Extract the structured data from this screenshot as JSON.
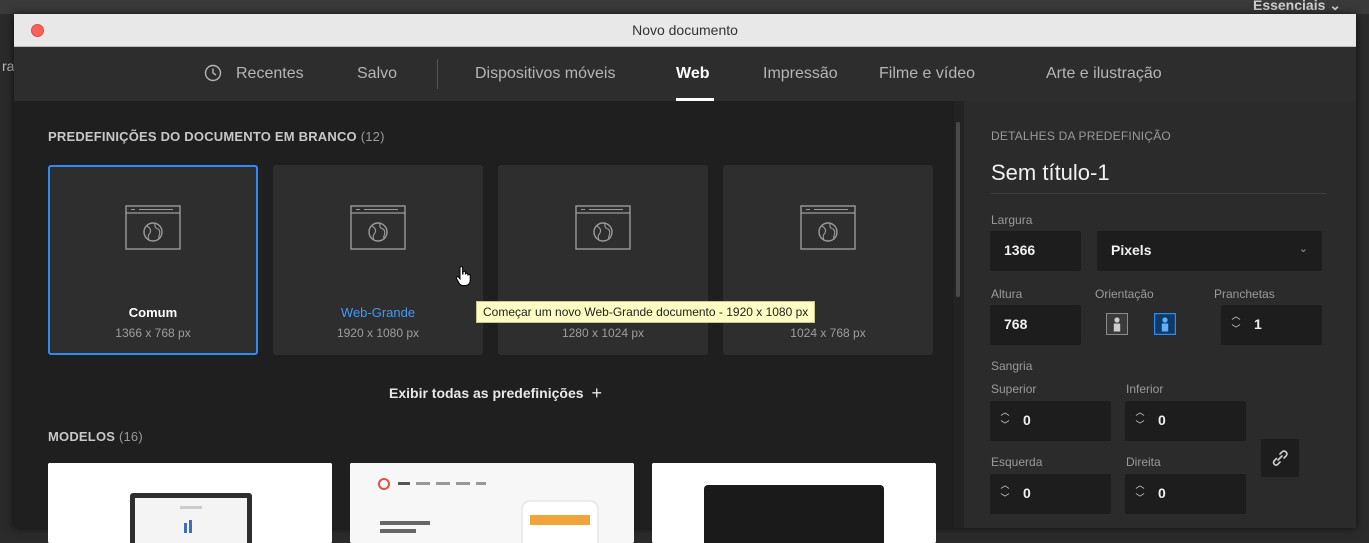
{
  "background": {
    "workspace_label": "Essenciais",
    "left_fragment": "ra"
  },
  "window": {
    "title": "Novo documento"
  },
  "tabs": [
    {
      "label": "Recentes"
    },
    {
      "label": "Salvo"
    },
    {
      "label": "Dispositivos móveis"
    },
    {
      "label": "Web",
      "active": true
    },
    {
      "label": "Impressão"
    },
    {
      "label": "Filme e vídeo"
    },
    {
      "label": "Arte e ilustração"
    }
  ],
  "presets_section": {
    "title": "PREDEFINIÇÕES DO DOCUMENTO EM BRANCO",
    "count": "(12)",
    "items": [
      {
        "name": "Comum",
        "size": "1366 x 768 px",
        "selected": true
      },
      {
        "name": "Web-Grande",
        "size": "1920 x 1080 px"
      },
      {
        "name": "",
        "size": "1280 x 1024 px"
      },
      {
        "name": "",
        "size": "1024 x 768 px"
      }
    ],
    "show_all": "Exibir todas as predefinições",
    "show_all_icon": "+"
  },
  "tooltip": {
    "text": "Começar um novo Web-Grande documento - 1920 x 1080 px"
  },
  "templates_section": {
    "title": "MODELOS",
    "count": "(16)"
  },
  "details": {
    "heading": "DETALHES DA PREDEFINIÇÃO",
    "doc_name": "Sem título-1",
    "width_label": "Largura",
    "width_value": "1366",
    "unit_value": "Pixels",
    "height_label": "Altura",
    "height_value": "768",
    "orientation_label": "Orientação",
    "artboards_label": "Pranchetas",
    "artboards_value": "1",
    "bleed_label": "Sangria",
    "top_label": "Superior",
    "top_value": "0",
    "bottom_label": "Inferior",
    "bottom_value": "0",
    "left_label": "Esquerda",
    "left_value": "0",
    "right_label": "Direita",
    "right_value": "0"
  },
  "colors": {
    "accent_blue": "#2f8af4",
    "link_blue": "#3e9af8",
    "tooltip_bg": "#fdfcc2"
  }
}
